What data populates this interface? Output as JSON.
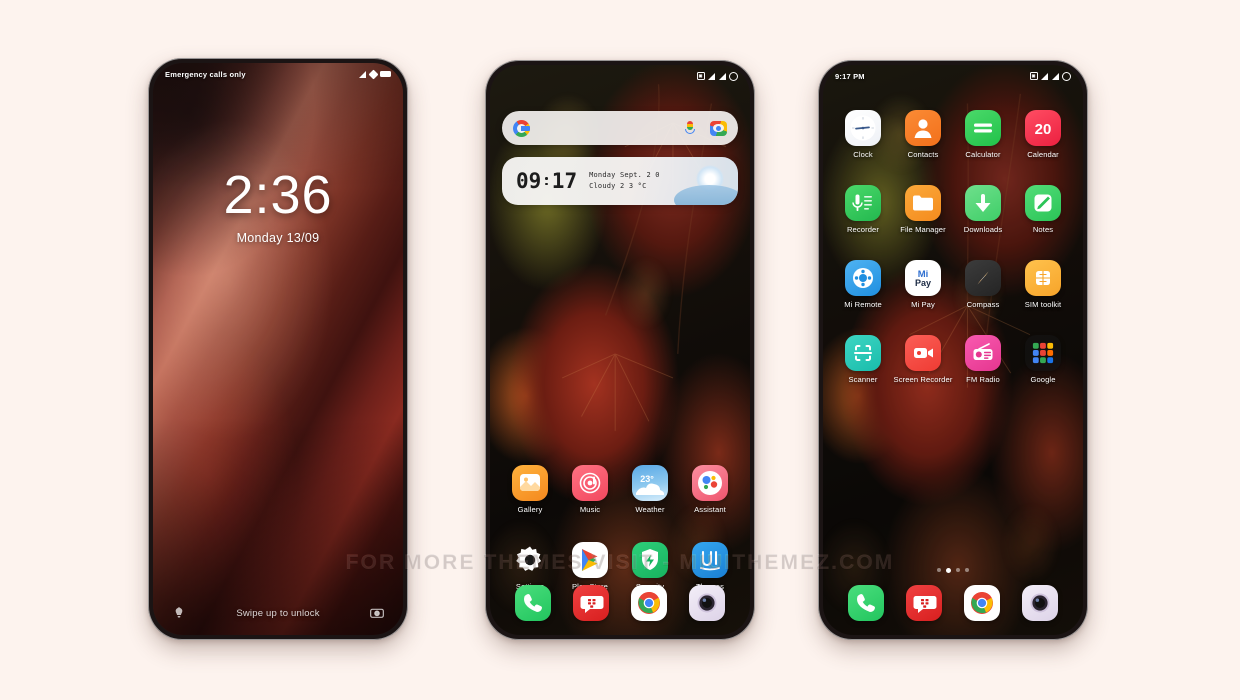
{
  "background_color": "#fdf3ee",
  "watermark": "FOR MORE THEMES VISIT - MIUITHEMEZ.COM",
  "phone1": {
    "name": "lock-screen",
    "statusbar": {
      "left_text": "Emergency calls only",
      "icons": [
        "signal-icon",
        "wifi-icon",
        "battery-icon"
      ]
    },
    "clock": {
      "time": "2:36",
      "date": "Monday 13/09"
    },
    "bottom": {
      "left_icon": "flashlight-icon",
      "hint": "Swipe up to unlock",
      "right_icon": "camera-icon"
    }
  },
  "phone2": {
    "name": "home-screen",
    "statusbar": {
      "left_text": "",
      "icons": [
        "screenshot-icon",
        "signal-icon",
        "signal-icon",
        "battery-icon"
      ]
    },
    "search": {
      "placeholder": "",
      "left_icon": "google-icon",
      "mic_icon": "microphone-icon",
      "lens_icon": "google-lens-icon"
    },
    "clock_widget": {
      "hours": "09",
      "minutes": "17",
      "date_line": "Monday  Sept.  2 0",
      "weather_line": "Cloudy  2 3  °C"
    },
    "apps_row1": [
      {
        "label": "Gallery",
        "icon": "gallery-icon"
      },
      {
        "label": "Music",
        "icon": "music-icon"
      },
      {
        "label": "Weather",
        "icon": "weather-icon",
        "badge": "23°"
      },
      {
        "label": "Assistant",
        "icon": "assistant-icon"
      }
    ],
    "apps_row2": [
      {
        "label": "Settings",
        "icon": "settings-gear-icon"
      },
      {
        "label": "Play Store",
        "icon": "play-store-icon"
      },
      {
        "label": "Security",
        "icon": "security-shield-icon"
      },
      {
        "label": "Themes",
        "icon": "themes-icon"
      }
    ],
    "dock": [
      {
        "label": "Phone",
        "icon": "phone-icon"
      },
      {
        "label": "Messages",
        "icon": "messages-icon"
      },
      {
        "label": "Chrome",
        "icon": "chrome-icon"
      },
      {
        "label": "Camera",
        "icon": "camera-lens-icon"
      }
    ]
  },
  "phone3": {
    "name": "app-drawer-screen",
    "statusbar": {
      "left_text": "9:17 PM",
      "icons": [
        "screenshot-icon",
        "signal-icon",
        "signal-icon",
        "battery-icon"
      ]
    },
    "apps_row1": [
      {
        "label": "Clock",
        "icon": "clock-icon"
      },
      {
        "label": "Contacts",
        "icon": "contacts-icon"
      },
      {
        "label": "Calculator",
        "icon": "calculator-icon"
      },
      {
        "label": "Calendar",
        "icon": "calendar-icon",
        "badge": "20"
      }
    ],
    "apps_row2": [
      {
        "label": "Recorder",
        "icon": "recorder-icon"
      },
      {
        "label": "File Manager",
        "icon": "folder-icon"
      },
      {
        "label": "Downloads",
        "icon": "download-arrow-icon"
      },
      {
        "label": "Notes",
        "icon": "notes-pencil-icon"
      }
    ],
    "apps_row3": [
      {
        "label": "Mi Remote",
        "icon": "remote-icon"
      },
      {
        "label": "Mi Pay",
        "icon": "mi-pay-icon"
      },
      {
        "label": "Compass",
        "icon": "compass-icon"
      },
      {
        "label": "SIM toolkit",
        "icon": "sim-card-icon"
      }
    ],
    "apps_row4": [
      {
        "label": "Scanner",
        "icon": "scanner-icon"
      },
      {
        "label": "Screen Recorder",
        "icon": "screen-recorder-icon"
      },
      {
        "label": "FM Radio",
        "icon": "fm-radio-icon"
      },
      {
        "label": "Google",
        "icon": "google-folder-icon"
      }
    ],
    "page_dots": {
      "count": 4,
      "active_index": 1
    },
    "dock": [
      {
        "label": "Phone",
        "icon": "phone-icon"
      },
      {
        "label": "Messages",
        "icon": "messages-icon"
      },
      {
        "label": "Chrome",
        "icon": "chrome-icon"
      },
      {
        "label": "Camera",
        "icon": "camera-lens-icon"
      }
    ]
  }
}
